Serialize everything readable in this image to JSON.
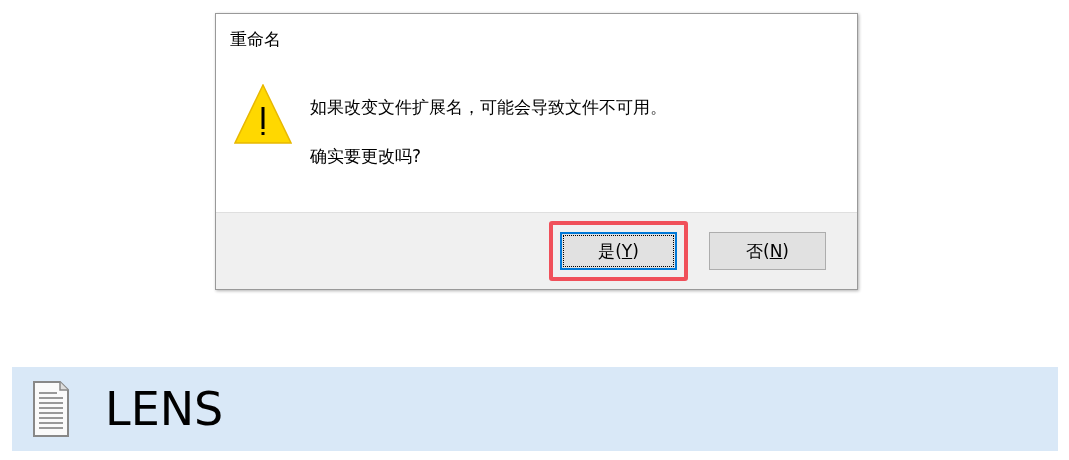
{
  "dialog": {
    "title": "重命名",
    "messages": [
      "如果改变文件扩展名，可能会导致文件不可用。",
      "确实要更改吗?"
    ],
    "buttons": [
      {
        "prefix": "是(",
        "access_key": "Y",
        "suffix": ")",
        "focused": true,
        "highlighted": true
      },
      {
        "prefix": "否(",
        "access_key": "N",
        "suffix": ")",
        "focused": false,
        "highlighted": false
      }
    ]
  },
  "file_row": {
    "name": "LENS",
    "selected": true
  }
}
